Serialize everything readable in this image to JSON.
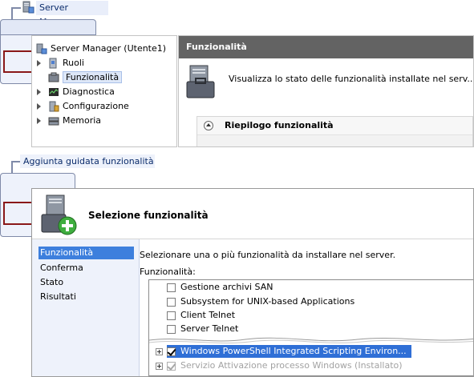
{
  "server_manager": {
    "tab_title": "Server Manager",
    "tree": {
      "root": "Server Manager (Utente1)",
      "items": [
        {
          "label": "Ruoli",
          "expandable": true
        },
        {
          "label": "Funzionalità",
          "expandable": false,
          "selected": true
        },
        {
          "label": "Diagnostica",
          "expandable": true
        },
        {
          "label": "Configurazione",
          "expandable": true
        },
        {
          "label": "Memoria",
          "expandable": true
        }
      ]
    },
    "detail": {
      "header": "Funzionalità",
      "description": "Visualizza lo stato delle funzionalità installate nel serv...",
      "section_title": "Riepilogo funzionalità"
    }
  },
  "wizard": {
    "tab_title": "Aggiunta guidata funzionalità",
    "title": "Selezione funzionalità",
    "nav": [
      {
        "label": "Funzionalità",
        "active": true
      },
      {
        "label": "Conferma",
        "active": false
      },
      {
        "label": "Stato",
        "active": false
      },
      {
        "label": "Risultati",
        "active": false
      }
    ],
    "instruction": "Selezionare una o più funzionalità da installare nel server.",
    "list_label": "Funzionalità:",
    "features": [
      {
        "label": "Gestione archivi SAN",
        "checked": false
      },
      {
        "label": "Subsystem for UNIX-based Applications",
        "checked": false
      },
      {
        "label": "Client Telnet",
        "checked": false
      },
      {
        "label": "Server Telnet",
        "checked": false
      },
      {
        "label": "Windows PowerShell Integrated Scripting Environ...",
        "checked": true,
        "expandable": true,
        "highlighted": true
      },
      {
        "label": "Servizio Attivazione processo Windows (Installato)",
        "checked": true,
        "expandable": true,
        "disabled": true
      }
    ]
  },
  "colors": {
    "accent_selection": "#2f6fd6",
    "header_bar": "#636363",
    "nav_background": "#eef2fb",
    "bracket": "#8a1818"
  }
}
